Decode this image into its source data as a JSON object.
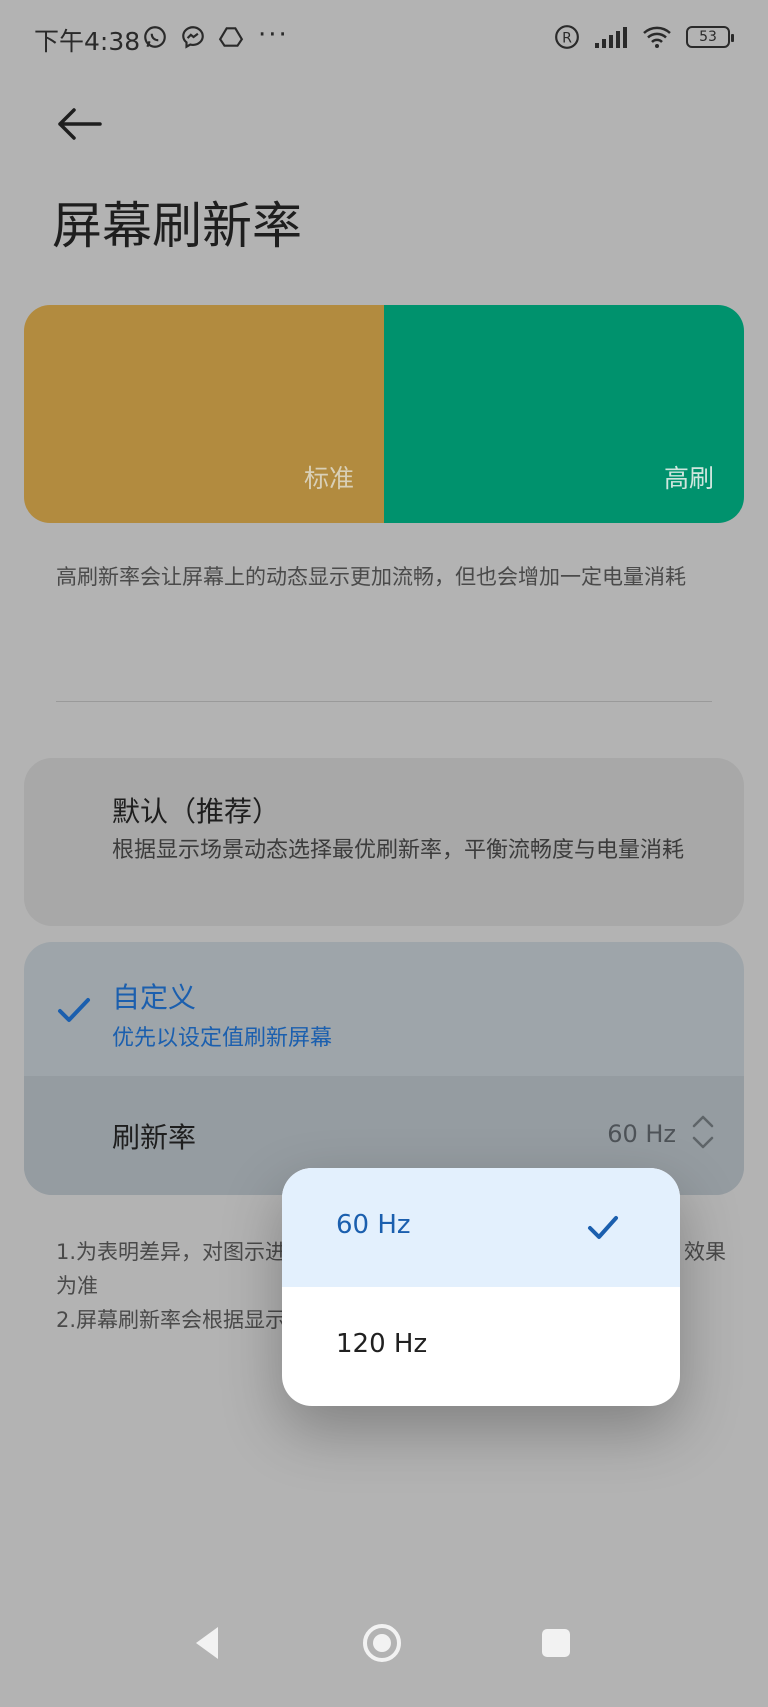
{
  "status_bar": {
    "time": "下午4:38",
    "icons_left": [
      "whatsapp-icon",
      "messenger-icon",
      "drive-icon"
    ],
    "more": "···",
    "icons_right": [
      "registered-icon",
      "signal-icon",
      "wifi-icon"
    ],
    "battery": "53"
  },
  "header": {
    "title": "屏幕刷新率"
  },
  "preview": {
    "standard_label": "标准",
    "high_label": "高刷",
    "colors": {
      "standard": "#b28b3f",
      "high": "#00926d"
    }
  },
  "description": "高刷新率会让屏幕上的动态显示更加流畅，但也会增加一定电量消耗",
  "options": {
    "default": {
      "title": "默认（推荐）",
      "subtitle": "根据显示场景动态选择最优刷新率，平衡流畅度与电量消耗"
    },
    "custom": {
      "title": "自定义",
      "subtitle": "优先以设定值刷新屏幕",
      "selected": true
    }
  },
  "refresh_row": {
    "label": "刷新率",
    "value": "60 Hz"
  },
  "notes": {
    "line1_start": "1.为表明差异，对图示进",
    "line1_end": "效果",
    "line2": "为准",
    "line3": "2.屏幕刷新率会根据显示"
  },
  "dropdown": {
    "items": [
      {
        "label": "60 Hz",
        "selected": true
      },
      {
        "label": "120 Hz",
        "selected": false
      }
    ]
  },
  "accent_color": "#1b5fae"
}
